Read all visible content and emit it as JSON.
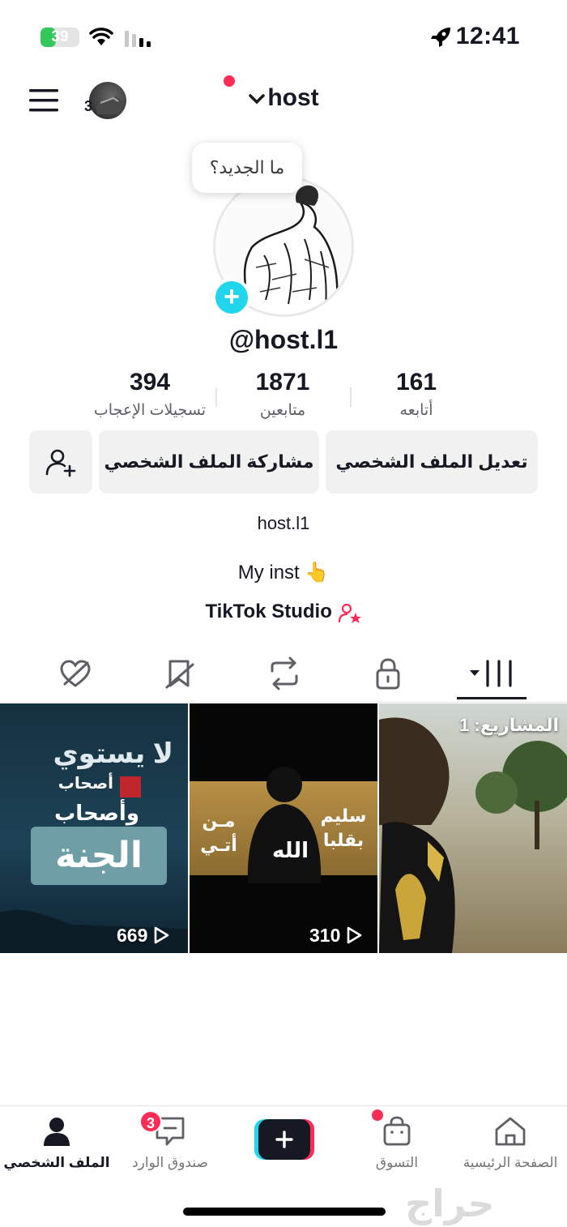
{
  "status_bar": {
    "battery": "39",
    "battery_level_percent": 39,
    "time": "12:41"
  },
  "header": {
    "menu_icon": "hamburger-menu-icon",
    "account_badge_count": "3",
    "title": "host",
    "accent": "#fe2c55"
  },
  "tooltip": {
    "text": "ما الجديد؟"
  },
  "profile": {
    "handle": "@host.l1",
    "stats": [
      {
        "value": "394",
        "label": "تسجيلات الإعجاب"
      },
      {
        "value": "1871",
        "label": "متابعين"
      },
      {
        "value": "161",
        "label": "أتابعه"
      }
    ],
    "buttons": {
      "share": "مشاركة الملف الشخصي",
      "edit": "تعديل الملف الشخصي"
    },
    "nickname": "host.l1",
    "bio": "My inst",
    "bio_emoji": "👆",
    "studio_link": "TikTok Studio"
  },
  "tabs": [
    "videos-tab-icon",
    "private-lock-icon",
    "reposts-icon",
    "favorites-icon",
    "liked-icon"
  ],
  "videos": [
    {
      "views": "669",
      "label": ""
    },
    {
      "views": "310",
      "label": ""
    },
    {
      "views": "",
      "label": "المشاريع: 1"
    }
  ],
  "video_text": {
    "v1_line1": "لا يستوي",
    "v1_line2": "أصحاب",
    "v1_line3": "وأصحاب",
    "v1_line4": "الجنة",
    "v2_left": "مـن أتـي",
    "v2_right": "سليم بقلبا",
    "v2_center": "الله"
  },
  "bottom_nav": {
    "profile": "الملف الشخصي",
    "inbox": "صندوق الوارد",
    "inbox_badge": "3",
    "shop": "التسوق",
    "home": "الصفحة الرئيسية"
  },
  "watermark": "حراج"
}
